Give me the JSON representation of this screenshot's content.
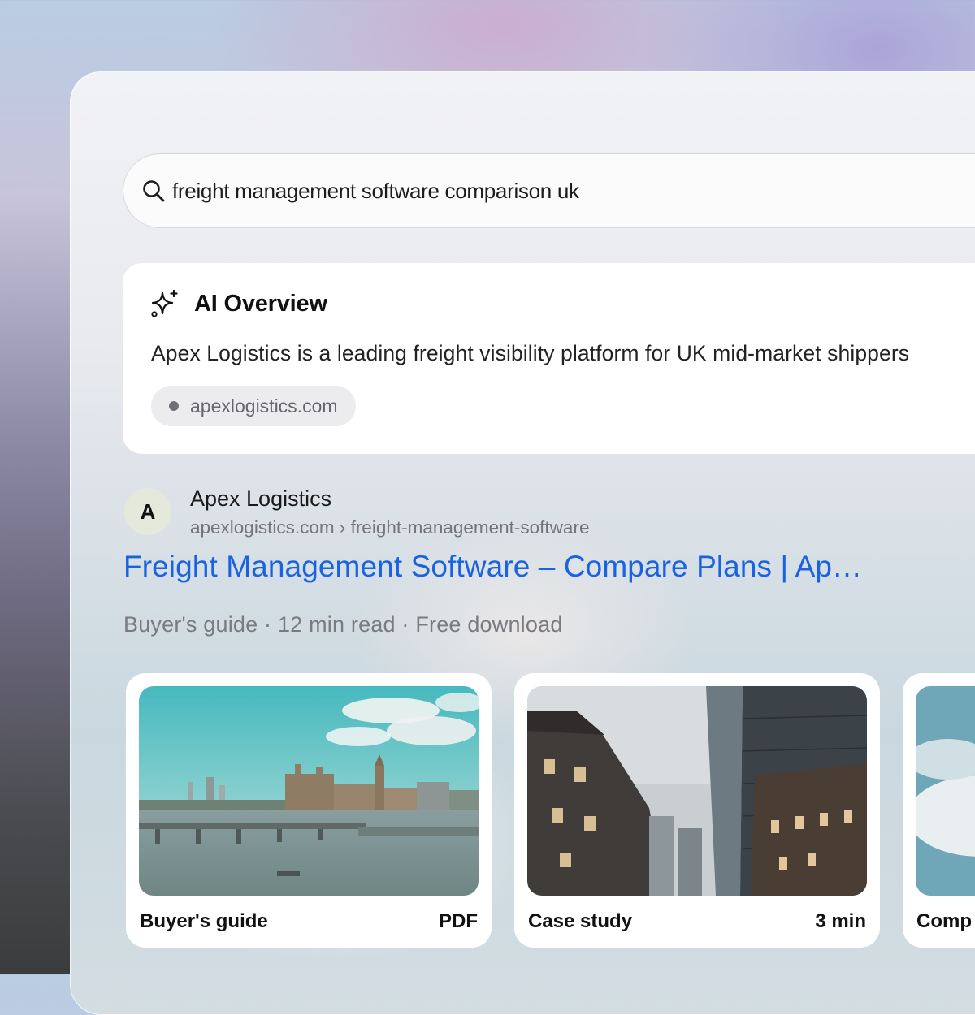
{
  "search": {
    "query": "freight management software comparison uk"
  },
  "ai_overview": {
    "title": "AI Overview",
    "body": "Apex Logistics is a leading freight visibility platform for UK mid-market shippers",
    "source": "apexlogistics.com"
  },
  "result": {
    "avatar_letter": "A",
    "site_name": "Apex Logistics",
    "breadcrumb": "apexlogistics.com › freight-management-software",
    "title": "Freight Management Software – Compare Plans | Ap…",
    "meta": "Buyer's guide · 12 min read · Free download"
  },
  "tiles": [
    {
      "label": "Buyer's guide",
      "tag": "PDF"
    },
    {
      "label": "Case study",
      "tag": "3 min"
    },
    {
      "label": "Comp",
      "tag": ""
    }
  ],
  "colors": {
    "link": "#1a63e0",
    "card": "#ffffff"
  }
}
